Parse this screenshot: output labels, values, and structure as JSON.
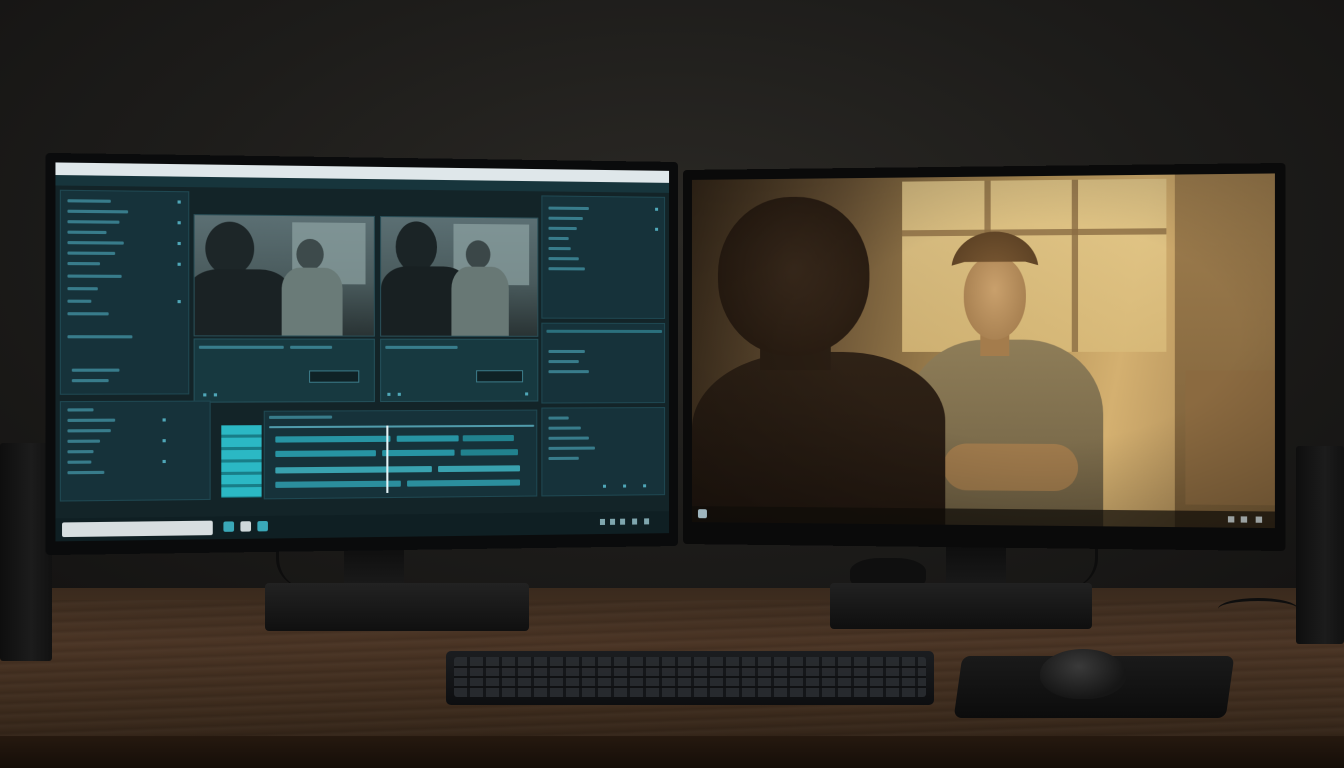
{
  "scene": {
    "description_colors": {
      "editor_bg": "#132428",
      "editor_accent": "#2bb8c4",
      "film_warm": "#d4b070",
      "desk_wood": "#4a3424"
    }
  },
  "left_monitor": {
    "app": {
      "title": "",
      "menu": [
        "",
        "",
        "",
        "",
        "",
        ""
      ]
    },
    "source_timecode": "",
    "program_timecode": "",
    "taskbar": {
      "search_placeholder": ""
    }
  },
  "right_monitor": {
    "playback": "fullscreen-preview"
  },
  "icons": [
    "search-icon",
    "windows-start-icon",
    "folder-icon",
    "app-icon"
  ]
}
